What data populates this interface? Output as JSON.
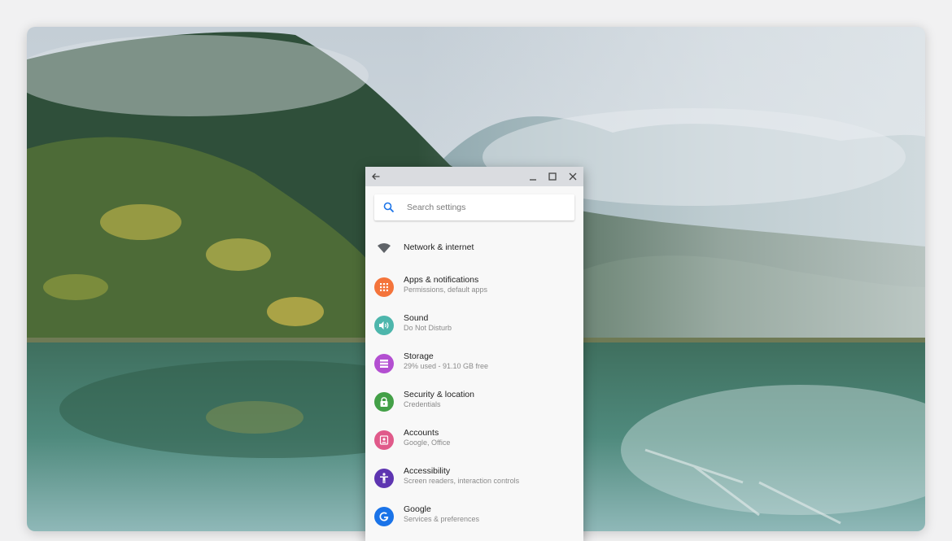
{
  "window": {
    "search_placeholder": "Search settings"
  },
  "settings": {
    "items": [
      {
        "title": "Network & internet",
        "icon": "wifi-icon",
        "color": "#5f6368"
      },
      {
        "title": "Apps & notifications",
        "subtitle": "Permissions, default apps",
        "icon": "apps-icon",
        "color": "#f4743b"
      },
      {
        "title": "Sound",
        "subtitle": "Do Not Disturb",
        "icon": "volume-icon",
        "color": "#4db6ac"
      },
      {
        "title": "Storage",
        "subtitle": "29% used - 91.10 GB free",
        "icon": "storage-icon",
        "color": "#b34fd1"
      },
      {
        "title": "Security & location",
        "subtitle": "Credentials",
        "icon": "lock-icon",
        "color": "#43a047"
      },
      {
        "title": "Accounts",
        "subtitle": "Google, Office",
        "icon": "account-icon",
        "color": "#e05a8a"
      },
      {
        "title": "Accessibility",
        "subtitle": "Screen readers, interaction controls",
        "icon": "accessibility-icon",
        "color": "#5e35b1"
      },
      {
        "title": "Google",
        "subtitle": "Services & preferences",
        "icon": "google-icon",
        "color": "#1a73e8"
      }
    ]
  }
}
